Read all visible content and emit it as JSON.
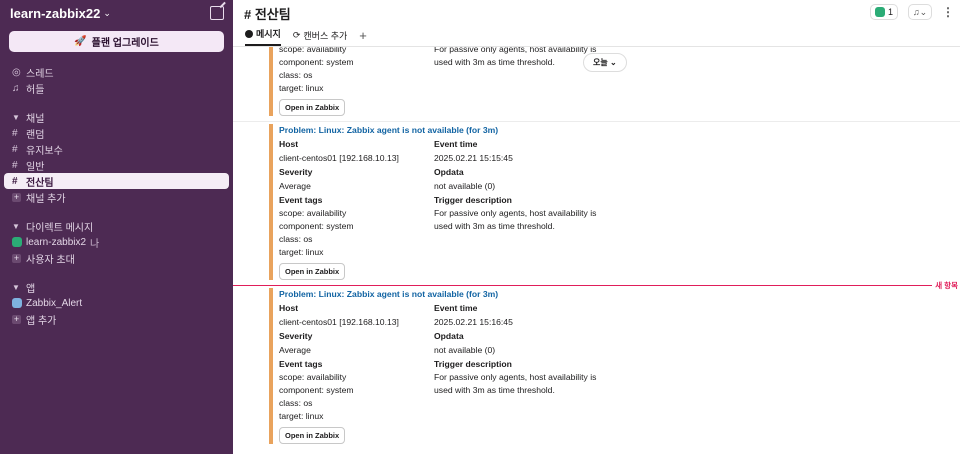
{
  "workspace": {
    "name": "learn-zabbix22"
  },
  "upgrade_label": "플랜 업그레이드",
  "nav": {
    "threads": "스레드",
    "huddles": "허들",
    "channels_header": "채널",
    "channels": [
      "랜덤",
      "유지보수",
      "일반",
      "전산팀"
    ],
    "add_channel": "채널 추가",
    "dm_header": "다이렉트 메시지",
    "dm_user": "learn-zabbix2",
    "dm_you": "나",
    "invite": "사용자 초대",
    "apps_header": "앱",
    "app_name": "Zabbix_Alert",
    "add_app": "앱 추가"
  },
  "header": {
    "channel_title": "# 전산팀",
    "member_count": "1",
    "tabs": [
      "메시지",
      "캔버스 추가"
    ]
  },
  "date_pill": "오늘",
  "new_items_label": "새 항목",
  "labels": {
    "host": "Host",
    "event_time": "Event time",
    "severity": "Severity",
    "opdata": "Opdata",
    "event_tags": "Event tags",
    "trigger_description": "Trigger description",
    "open_btn": "Open in Zabbix"
  },
  "partial_message": {
    "tags": [
      "scope: availability",
      "component: system",
      "class: os",
      "target: linux"
    ],
    "trigger_lines": [
      "For passive only agents, host availability is",
      "used with 3m as time threshold."
    ]
  },
  "messages": [
    {
      "title": "Problem: Linux: Zabbix agent is not available (for 3m)",
      "host": "client-centos01 [192.168.10.13]",
      "event_time": "2025.02.21 15:15:45",
      "severity": "Average",
      "opdata": "not available (0)",
      "tags": [
        "scope: availability",
        "component: system",
        "class: os",
        "target: linux"
      ],
      "trigger_lines": [
        "For passive only agents, host availability is",
        "used with 3m as time threshold."
      ]
    },
    {
      "title": "Problem: Linux: Zabbix agent is not available (for 3m)",
      "host": "client-centos01 [192.168.10.13]",
      "event_time": "2025.02.21 15:16:45",
      "severity": "Average",
      "opdata": "not available (0)",
      "tags": [
        "scope: availability",
        "component: system",
        "class: os",
        "target: linux"
      ],
      "trigger_lines": [
        "For passive only agents, host availability is",
        "used with 3m as time threshold."
      ]
    }
  ],
  "colors": {
    "sidebar": "#4d2a53",
    "accent_bar": "#e9a35d",
    "link": "#1264a3",
    "new_marker": "#e01e5a"
  }
}
